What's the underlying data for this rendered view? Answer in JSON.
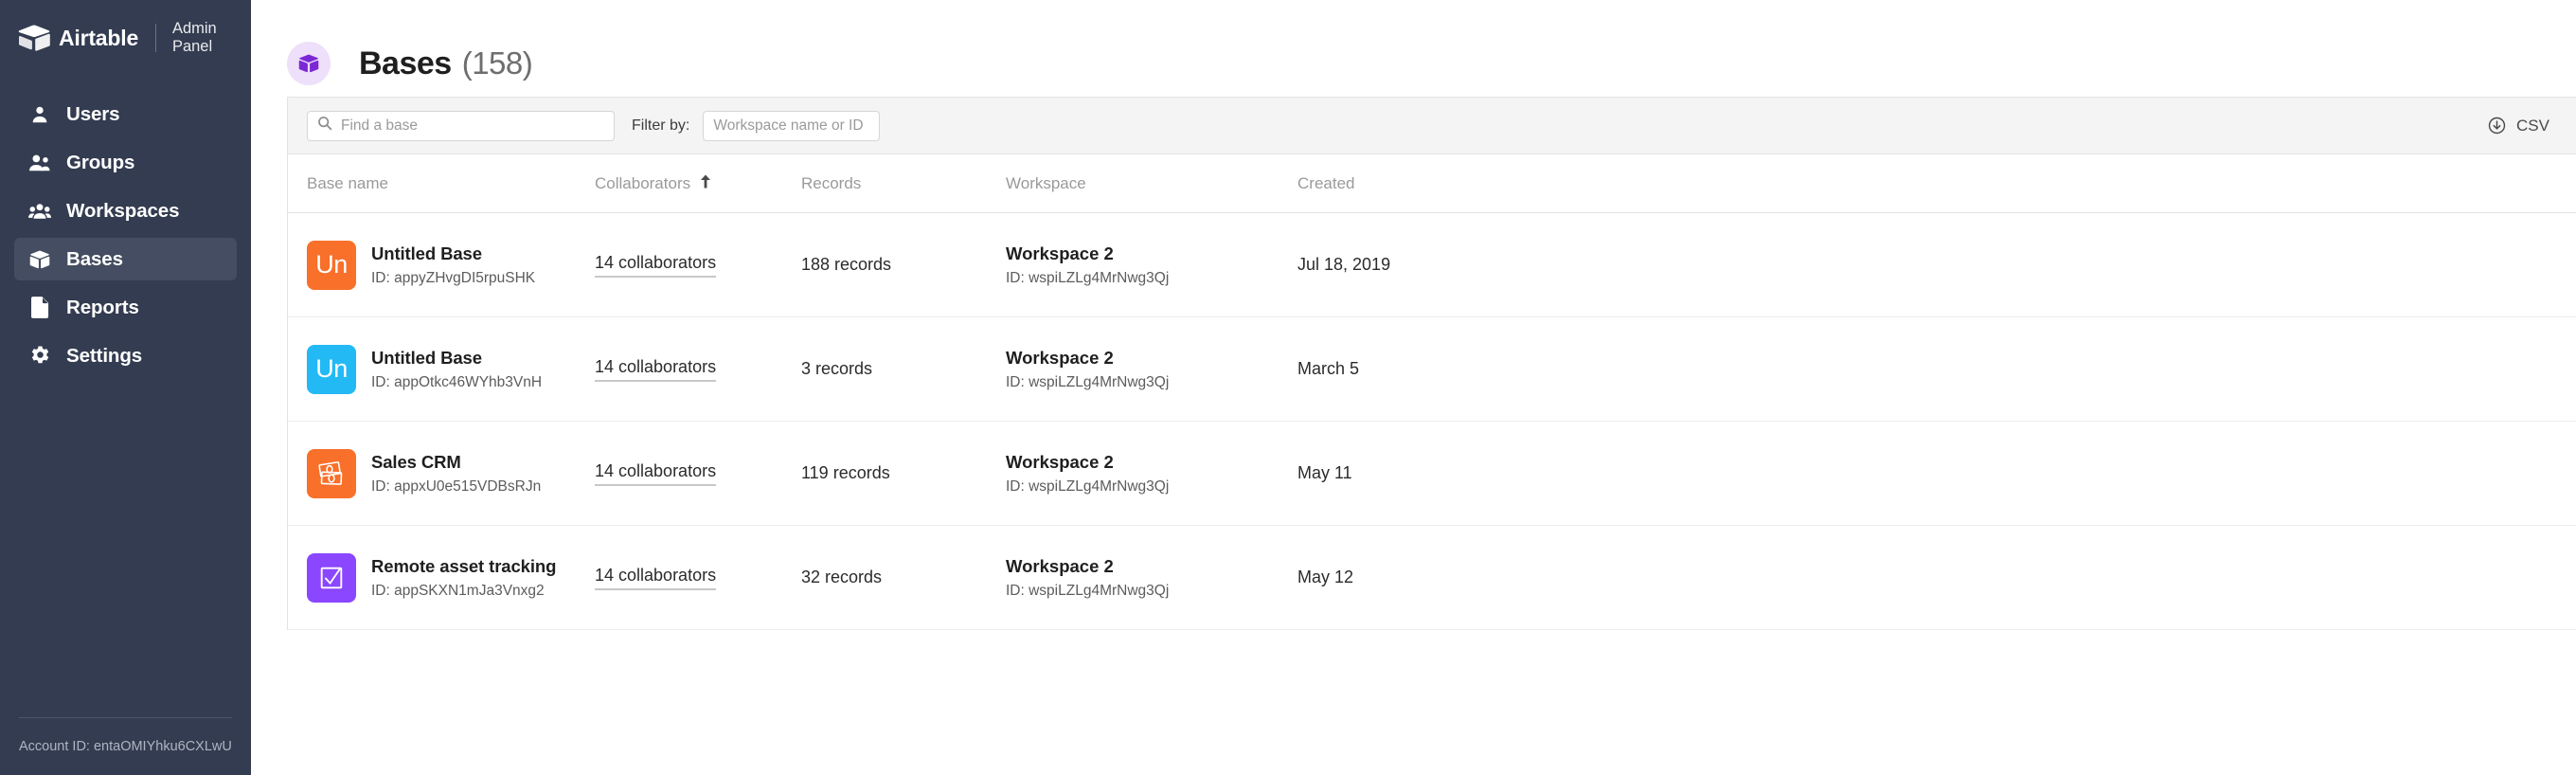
{
  "sidebar": {
    "brand": {
      "name": "Airtable",
      "subtitle": "Admin Panel",
      "logo_icon": "airtable-logo-icon"
    },
    "items": [
      {
        "label": "Users",
        "icon": "person-icon",
        "active": false
      },
      {
        "label": "Groups",
        "icon": "people-icon",
        "active": false
      },
      {
        "label": "Workspaces",
        "icon": "group-icon",
        "active": false
      },
      {
        "label": "Bases",
        "icon": "cube-icon",
        "active": true
      },
      {
        "label": "Reports",
        "icon": "document-icon",
        "active": false
      },
      {
        "label": "Settings",
        "icon": "gear-icon",
        "active": false
      }
    ],
    "account_id": "Account ID: entaOMIYhku6CXLwU",
    "background_color": "#333c50",
    "active_item_color": "#444d61"
  },
  "page": {
    "badge_icon": "cube-icon",
    "badge_bg": "#eedffa",
    "badge_fg": "#7c28d4",
    "title": "Bases",
    "count": "(158)"
  },
  "toolbar": {
    "search": {
      "placeholder": "Find a base",
      "value": "",
      "icon": "search-icon"
    },
    "filter_label": "Filter by:",
    "filter": {
      "placeholder": "Workspace name or ID",
      "value": ""
    },
    "csv": {
      "label": "CSV",
      "icon": "download-icon"
    }
  },
  "table": {
    "columns": [
      {
        "label": "Base name",
        "sorted": false
      },
      {
        "label": "Collaborators",
        "sorted": true,
        "sort_icon": "sort-asc-arrow-icon"
      },
      {
        "label": "Records",
        "sorted": false
      },
      {
        "label": "Workspace",
        "sorted": false
      },
      {
        "label": "Created",
        "sorted": false
      }
    ],
    "rows": [
      {
        "icon": {
          "type": "monogram",
          "text": "Un",
          "color": "#f8702a",
          "name": "base-monogram-icon"
        },
        "name": "Untitled Base",
        "id": "ID: appyZHvgDI5rpuSHK",
        "collaborators": "14 collaborators",
        "records": "188 records",
        "workspace_name": "Workspace 2",
        "workspace_id": "ID: wspiLZLg4MrNwg3Qj",
        "created": "Jul 18, 2019"
      },
      {
        "icon": {
          "type": "monogram",
          "text": "Un",
          "color": "#23b9f5",
          "name": "base-monogram-icon"
        },
        "name": "Untitled Base",
        "id": "ID: appOtkc46WYhb3VnH",
        "collaborators": "14 collaborators",
        "records": "3 records",
        "workspace_name": "Workspace 2",
        "workspace_id": "ID: wspiLZLg4MrNwg3Qj",
        "created": "March 5"
      },
      {
        "icon": {
          "type": "money",
          "text": "",
          "color": "#f8702a",
          "name": "money-icon"
        },
        "name": "Sales CRM",
        "id": "ID: appxU0e515VDBsRJn",
        "collaborators": "14 collaborators",
        "records": "119 records",
        "workspace_name": "Workspace 2",
        "workspace_id": "ID: wspiLZLg4MrNwg3Qj",
        "created": "May 11"
      },
      {
        "icon": {
          "type": "check",
          "text": "",
          "color": "#8b46ff",
          "name": "checkbox-icon"
        },
        "name": "Remote asset tracking",
        "id": "ID: appSKXN1mJa3Vnxg2",
        "collaborators": "14 collaborators",
        "records": "32 records",
        "workspace_name": "Workspace 2",
        "workspace_id": "ID: wspiLZLg4MrNwg3Qj",
        "created": "May 12"
      }
    ]
  }
}
